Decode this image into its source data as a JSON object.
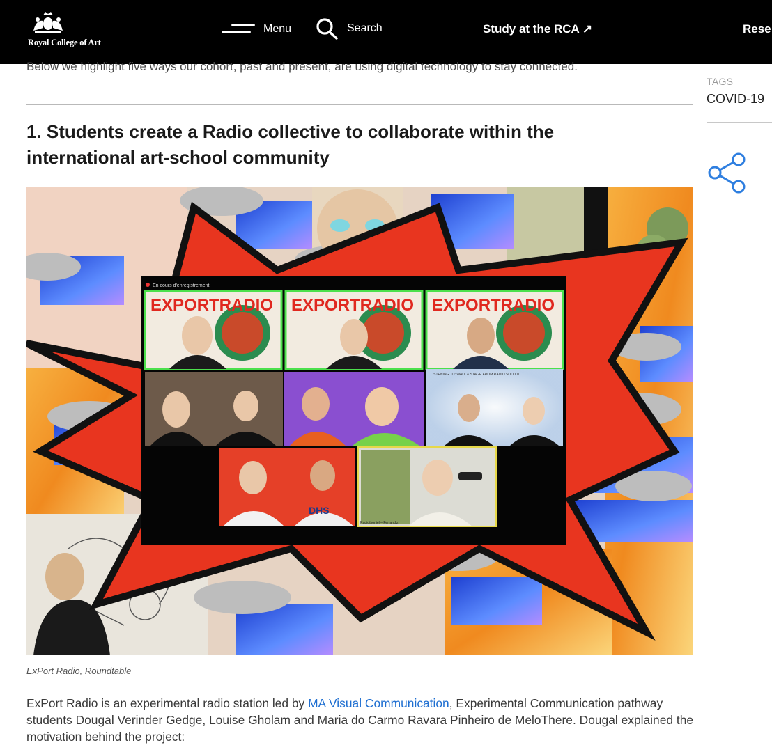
{
  "header": {
    "logo_text": "Royal College of Art",
    "menu_label": "Menu",
    "search_label": "Search",
    "study_link": "Study at the RCA ↗",
    "research_link": "Rese"
  },
  "article": {
    "intro": "Below we highlight five ways our cohort, past and present, are using digital technology to stay connected.",
    "section_heading": "1. Students create a Radio collective to collaborate within the international art-school community",
    "image": {
      "banner_text": "EXPORTRADIO",
      "recording_label": "En cours d'enregistrement",
      "panel_text": "LISTENING TO: WALL & STAGE FROM RADIO SOLO 10",
      "shirt_text": "DHS",
      "participant_label": "Radiothoniel – Ferrandiz"
    },
    "caption": "ExPort Radio, Roundtable",
    "body": {
      "before_link": "ExPort Radio is an experimental radio station led by ",
      "link_text": "MA Visual Communication",
      "after_link": ", Experimental Communication pathway students Dougal Verinder Gedge, Louise Gholam and Maria do Carmo Ravara Pinheiro de MeloThere. Dougal explained the motivation behind the project:"
    }
  },
  "sidebar": {
    "tags_label": "TAGS",
    "tag": "COVID-19",
    "share_icon": "share-icon"
  },
  "colors": {
    "header_bg": "#000000",
    "link_blue": "#1f6fd1",
    "share_blue": "#2f7fe0",
    "burst_red": "#e8351f"
  }
}
